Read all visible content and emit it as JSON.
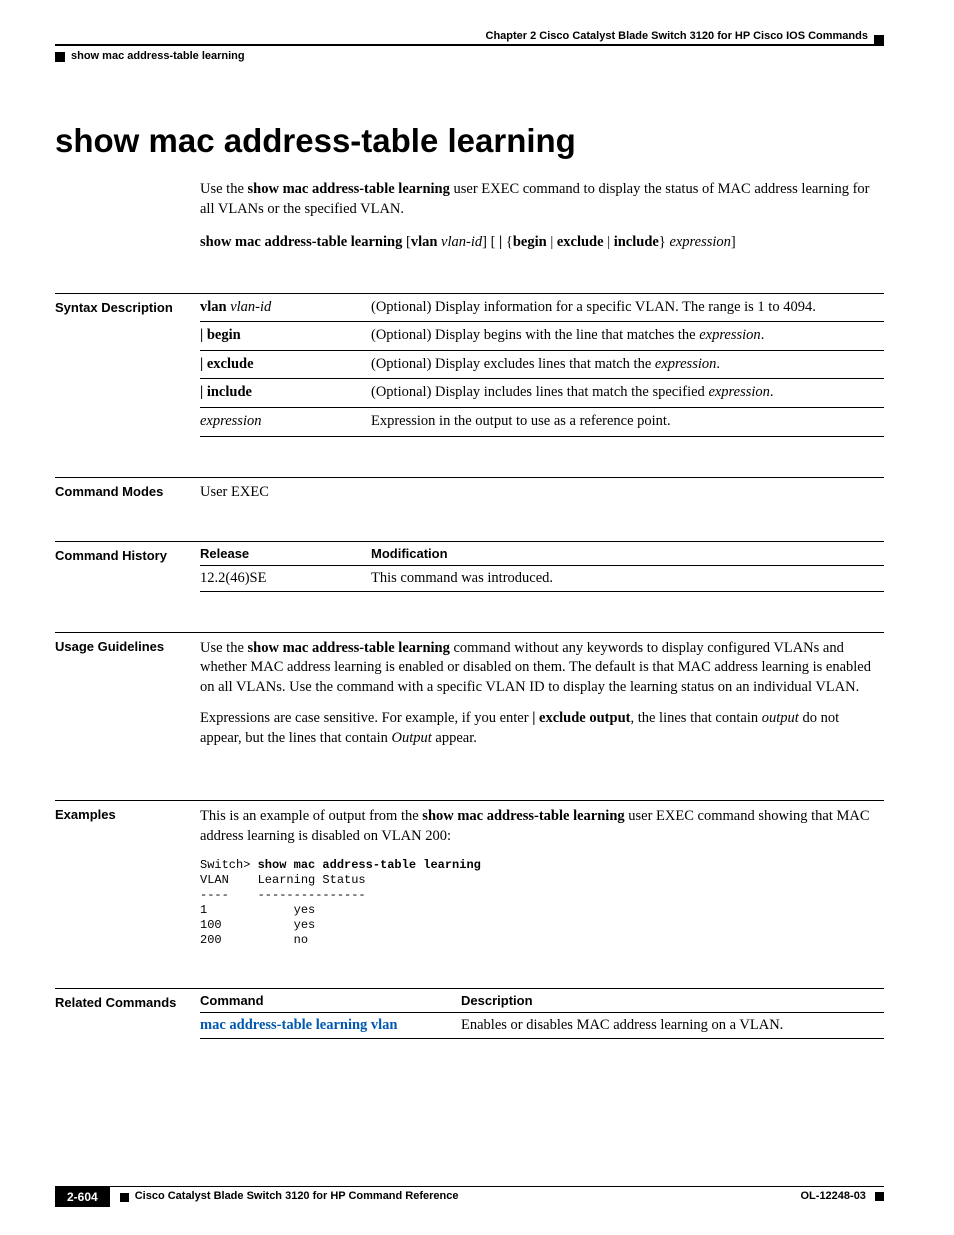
{
  "header": {
    "chapter": "Chapter 2  Cisco Catalyst Blade Switch 3120 for HP Cisco IOS Commands",
    "breadcrumb": "show mac address-table learning"
  },
  "title": "show mac address-table learning",
  "intro": {
    "p1_pre": "Use the ",
    "p1_cmd": "show mac address-table learning",
    "p1_post": " user EXEC command to display the status of MAC address learning for all VLANs or the specified VLAN.",
    "syn_cmd": "show mac address-table learning ",
    "syn_vlan_b": "vlan",
    "syn_vlan_i": "vlan-id",
    "syn_mid1": " [ ",
    "syn_pipe": "|",
    "syn_mid2": " {",
    "syn_begin": "begin",
    "syn_sep1": " | ",
    "syn_exclude": "exclude",
    "syn_sep2": " | ",
    "syn_include": "include",
    "syn_mid3": "} ",
    "syn_expr": "expression",
    "syn_end": "]"
  },
  "sections": {
    "syntax_label": "Syntax Description",
    "modes_label": "Command Modes",
    "modes_value": "User EXEC",
    "history_label": "Command History",
    "usage_label": "Usage Guidelines",
    "examples_label": "Examples",
    "related_label": "Related Commands"
  },
  "syntax_rows": [
    {
      "term_b": "vlan ",
      "term_i": "vlan-id",
      "desc_pre": "(Optional) Display information for a specific VLAN. The range is 1 to 4094.",
      "desc_i": ""
    },
    {
      "term_b": "| begin",
      "term_i": "",
      "desc_pre": "(Optional) Display begins with the line that matches the ",
      "desc_i": "expression",
      "desc_post": "."
    },
    {
      "term_b": "| exclude",
      "term_i": "",
      "desc_pre": "(Optional) Display excludes lines that match the ",
      "desc_i": "expression",
      "desc_post": "."
    },
    {
      "term_b": "| include",
      "term_i": "",
      "desc_pre": "(Optional) Display includes lines that match the specified ",
      "desc_i": "expression",
      "desc_post": "."
    },
    {
      "term_b": "",
      "term_i": "expression",
      "desc_pre": "Expression in the output to use as a reference point.",
      "desc_i": ""
    }
  ],
  "history": {
    "h1": "Release",
    "h2": "Modification",
    "release": "12.2(46)SE",
    "mod": "This command was introduced."
  },
  "usage": {
    "p1_pre": "Use the ",
    "p1_b": "show mac address-table learning",
    "p1_post": " command without any keywords to display configured VLANs and whether MAC address learning is enabled or disabled on them. The default is that MAC address learning is enabled on all VLANs. Use the command with a specific VLAN ID to display the learning status on an individual VLAN.",
    "p2_a": "Expressions are case sensitive. For example, if you enter ",
    "p2_b": "| exclude output",
    "p2_c": ", the lines that contain ",
    "p2_d": "output",
    "p2_e": " do not appear, but the lines that contain ",
    "p2_f": "Output",
    "p2_g": " appear."
  },
  "examples": {
    "p_pre": "This is an example of output from the ",
    "p_b": "show mac address-table learning",
    "p_post": " user EXEC command showing that MAC address learning is disabled on VLAN 200:",
    "prompt": "Switch> ",
    "cmd": "show mac address-table learning",
    "out": "VLAN    Learning Status\n----    ---------------\n1            yes\n100          yes\n200          no"
  },
  "related": {
    "h1": "Command",
    "h2": "Description",
    "cmd": "mac address-table learning vlan",
    "desc": "Enables or disables MAC address learning on a VLAN."
  },
  "footer": {
    "page": "2-604",
    "title": "Cisco Catalyst Blade Switch 3120 for HP Command Reference",
    "docnum": "OL-12248-03"
  }
}
